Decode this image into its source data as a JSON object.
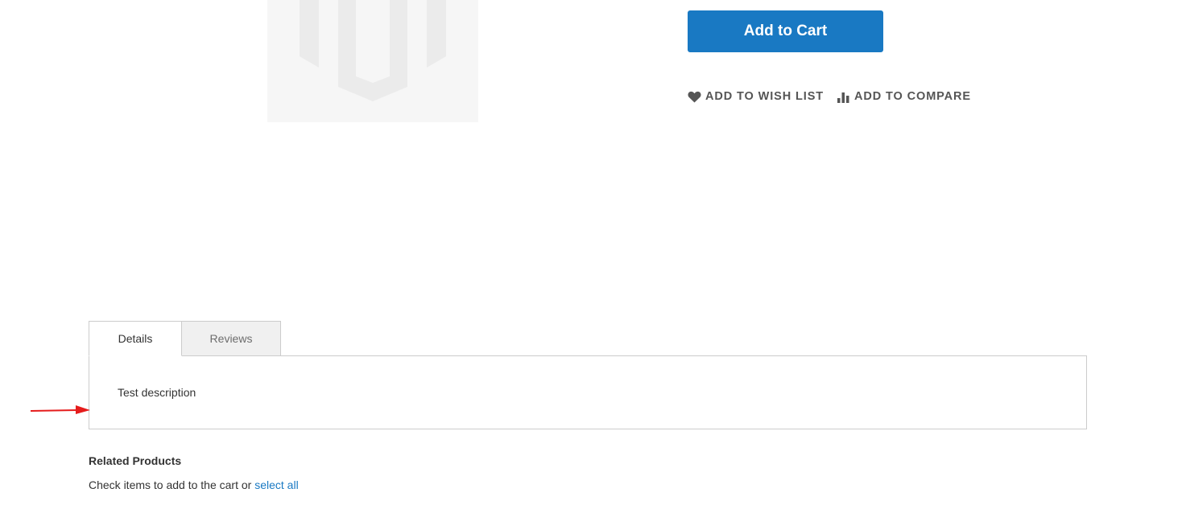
{
  "product": {
    "image": {
      "icon": "magento-placeholder-logo"
    }
  },
  "actions": {
    "add_to_cart_label": "Add to Cart",
    "wishlist_label": "Add to Wish List",
    "wishlist_icon": "heart-icon",
    "compare_label": "Add to Compare",
    "compare_icon": "bar-chart-icon"
  },
  "tabs": [
    {
      "label": "Details",
      "active": true
    },
    {
      "label": "Reviews",
      "active": false
    }
  ],
  "details_panel": {
    "description": "Test description"
  },
  "annotation": {
    "arrow_color": "#e51c1c"
  },
  "related": {
    "title": "Related Products",
    "hint_text": "Check items to add to the cart or",
    "select_all_label": "select all"
  },
  "colors": {
    "primary": "#1979c3",
    "link": "#1979c3",
    "tab_inactive_bg": "#f0f0f0",
    "border": "#cccccc"
  }
}
